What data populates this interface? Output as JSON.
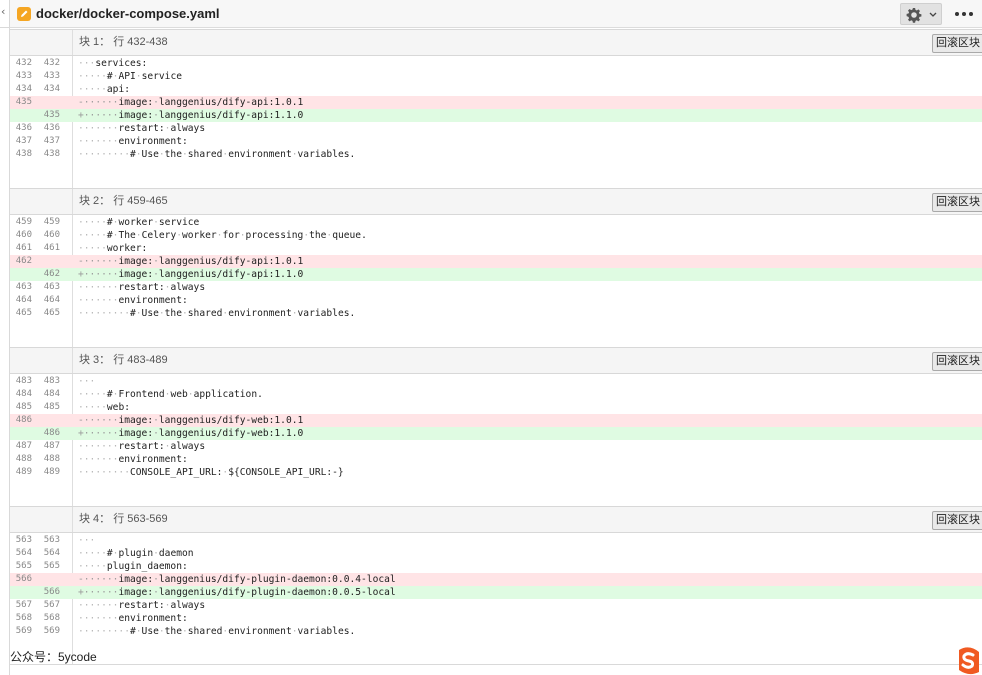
{
  "header": {
    "file_path": "docker/docker-compose.yaml",
    "edit_icon": "pencil-icon",
    "settings_icon": "gear-icon",
    "dropdown_icon": "chevron-down-icon",
    "more_icon": "more-horizontal-icon"
  },
  "colors": {
    "deleted_bg": "#ffe4e6",
    "added_bg": "#dffbe2",
    "header_bg": "#f7f7f7",
    "hunk_header_bg": "#f5f5f5",
    "edit_icon": "#f5a623"
  },
  "hunks": [
    {
      "title": "块 1： 行 432-438",
      "revert_label": "回滚区块",
      "lines": [
        {
          "type": "ctx",
          "old": "432",
          "new": "432",
          "indent": 3,
          "text": "services:"
        },
        {
          "type": "ctx",
          "old": "433",
          "new": "433",
          "indent": 5,
          "text": "# API service"
        },
        {
          "type": "ctx",
          "old": "434",
          "new": "434",
          "indent": 5,
          "text": "api:"
        },
        {
          "type": "del",
          "old": "435",
          "new": "",
          "indent": 7,
          "text": "image: langgenius/dify-api:1.0.1"
        },
        {
          "type": "add",
          "old": "",
          "new": "435",
          "indent": 7,
          "text": "image: langgenius/dify-api:1.1.0"
        },
        {
          "type": "ctx",
          "old": "436",
          "new": "436",
          "indent": 7,
          "text": "restart: always"
        },
        {
          "type": "ctx",
          "old": "437",
          "new": "437",
          "indent": 7,
          "text": "environment:"
        },
        {
          "type": "ctx",
          "old": "438",
          "new": "438",
          "indent": 9,
          "text": "# Use the shared environment variables."
        }
      ]
    },
    {
      "title": "块 2： 行 459-465",
      "revert_label": "回滚区块",
      "lines": [
        {
          "type": "ctx",
          "old": "459",
          "new": "459",
          "indent": 5,
          "text": "# worker service"
        },
        {
          "type": "ctx",
          "old": "460",
          "new": "460",
          "indent": 5,
          "text": "# The Celery worker for processing the queue."
        },
        {
          "type": "ctx",
          "old": "461",
          "new": "461",
          "indent": 5,
          "text": "worker:"
        },
        {
          "type": "del",
          "old": "462",
          "new": "",
          "indent": 7,
          "text": "image: langgenius/dify-api:1.0.1"
        },
        {
          "type": "add",
          "old": "",
          "new": "462",
          "indent": 7,
          "text": "image: langgenius/dify-api:1.1.0"
        },
        {
          "type": "ctx",
          "old": "463",
          "new": "463",
          "indent": 7,
          "text": "restart: always"
        },
        {
          "type": "ctx",
          "old": "464",
          "new": "464",
          "indent": 7,
          "text": "environment:"
        },
        {
          "type": "ctx",
          "old": "465",
          "new": "465",
          "indent": 9,
          "text": "# Use the shared environment variables."
        }
      ]
    },
    {
      "title": "块 3： 行 483-489",
      "revert_label": "回滚区块",
      "lines": [
        {
          "type": "ctx",
          "old": "483",
          "new": "483",
          "indent": 3,
          "text": ""
        },
        {
          "type": "ctx",
          "old": "484",
          "new": "484",
          "indent": 5,
          "text": "# Frontend web application."
        },
        {
          "type": "ctx",
          "old": "485",
          "new": "485",
          "indent": 5,
          "text": "web:"
        },
        {
          "type": "del",
          "old": "486",
          "new": "",
          "indent": 7,
          "text": "image: langgenius/dify-web:1.0.1"
        },
        {
          "type": "add",
          "old": "",
          "new": "486",
          "indent": 7,
          "text": "image: langgenius/dify-web:1.1.0"
        },
        {
          "type": "ctx",
          "old": "487",
          "new": "487",
          "indent": 7,
          "text": "restart: always"
        },
        {
          "type": "ctx",
          "old": "488",
          "new": "488",
          "indent": 7,
          "text": "environment:"
        },
        {
          "type": "ctx",
          "old": "489",
          "new": "489",
          "indent": 9,
          "text": "CONSOLE_API_URL: ${CONSOLE_API_URL:-}"
        }
      ]
    },
    {
      "title": "块 4： 行 563-569",
      "revert_label": "回滚区块",
      "lines": [
        {
          "type": "ctx",
          "old": "563",
          "new": "563",
          "indent": 3,
          "text": ""
        },
        {
          "type": "ctx",
          "old": "564",
          "new": "564",
          "indent": 5,
          "text": "# plugin daemon"
        },
        {
          "type": "ctx",
          "old": "565",
          "new": "565",
          "indent": 5,
          "text": "plugin_daemon:"
        },
        {
          "type": "del",
          "old": "566",
          "new": "",
          "indent": 7,
          "text": "image: langgenius/dify-plugin-daemon:0.0.4-local"
        },
        {
          "type": "add",
          "old": "",
          "new": "566",
          "indent": 7,
          "text": "image: langgenius/dify-plugin-daemon:0.0.5-local"
        },
        {
          "type": "ctx",
          "old": "567",
          "new": "567",
          "indent": 7,
          "text": "restart: always"
        },
        {
          "type": "ctx",
          "old": "568",
          "new": "568",
          "indent": 7,
          "text": "environment:"
        },
        {
          "type": "ctx",
          "old": "569",
          "new": "569",
          "indent": 9,
          "text": "# Use the shared environment variables."
        }
      ]
    }
  ],
  "watermark": "公众号：5ycode",
  "logo_icon": "sogou-s-logo"
}
